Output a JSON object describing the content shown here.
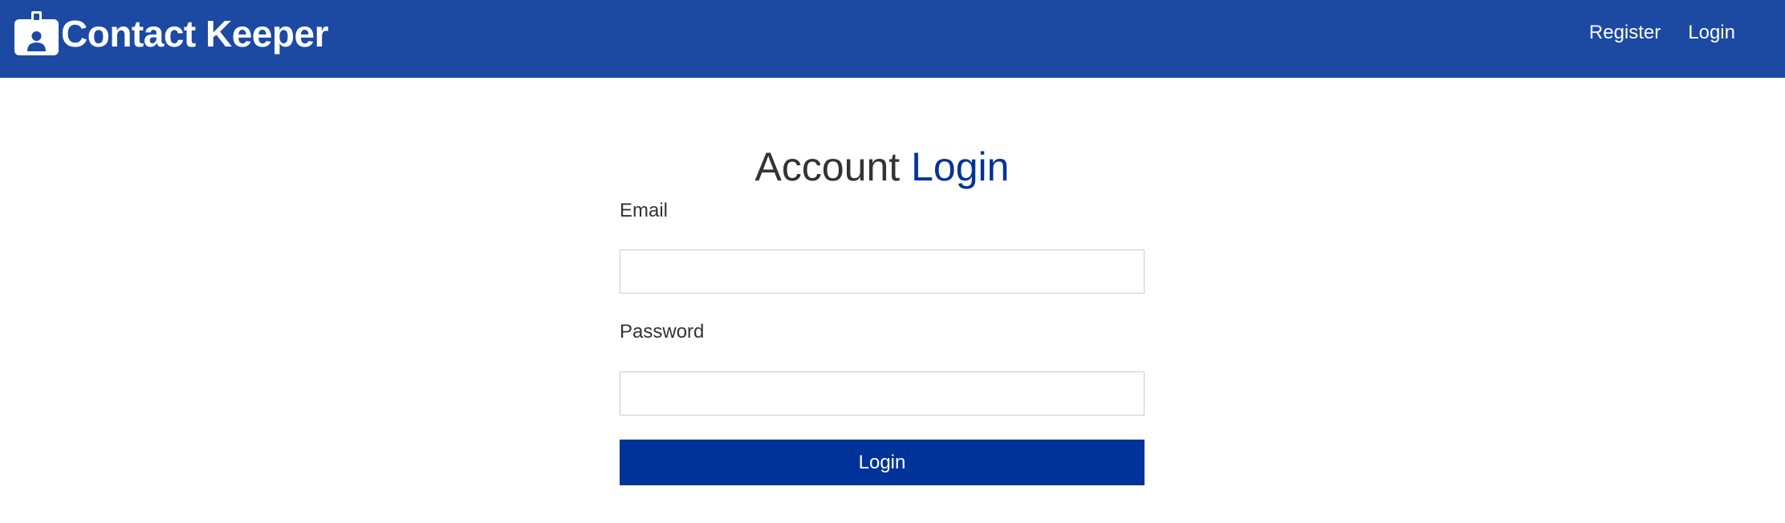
{
  "navbar": {
    "brand_icon": "id-badge-icon",
    "brand_title": "Contact Keeper",
    "links": [
      {
        "label": "Register"
      },
      {
        "label": "Login"
      }
    ],
    "background_color": "#1c4aa3"
  },
  "form": {
    "heading_prefix": "Account",
    "heading_accent": "Login",
    "email_label": "Email",
    "email_value": "",
    "password_label": "Password",
    "password_value": "",
    "submit_label": "Login",
    "accent_color": "#003399"
  }
}
